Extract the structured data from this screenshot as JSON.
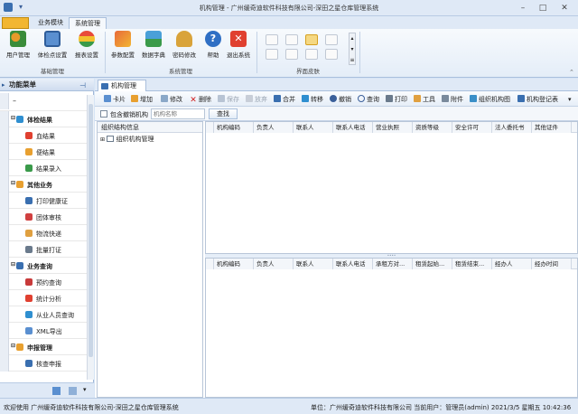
{
  "window": {
    "title": "机构管理 - 广州缓奇迪软件科技有限公司-深田之星仓库管理系统"
  },
  "ribbon_tabs": [
    "",
    "业务模块",
    "系统管理"
  ],
  "ribbon": {
    "buttons": [
      "用户管理",
      "体检点设置",
      "报表设置",
      "参数配置",
      "数据字典",
      "密码修改",
      "帮助",
      "退出系统"
    ],
    "groups": [
      "基础管理",
      "系统管理",
      "界面皮肤"
    ]
  },
  "sidebar": {
    "title": "功能菜单",
    "items": [
      {
        "label": "体检结果",
        "cat": true
      },
      {
        "label": "血结果",
        "cat": false
      },
      {
        "label": "便结果",
        "cat": false
      },
      {
        "label": "结果录入",
        "cat": false
      },
      {
        "label": "其他业务",
        "cat": true
      },
      {
        "label": "打印健康证",
        "cat": false
      },
      {
        "label": "团体审核",
        "cat": false
      },
      {
        "label": "物流快递",
        "cat": false
      },
      {
        "label": "批量打证",
        "cat": false
      },
      {
        "label": "业务查询",
        "cat": true
      },
      {
        "label": "预约查询",
        "cat": false
      },
      {
        "label": "统计分析",
        "cat": false
      },
      {
        "label": "从业人员查询",
        "cat": false
      },
      {
        "label": "XML导出",
        "cat": false
      },
      {
        "label": "申报管理",
        "cat": true
      },
      {
        "label": "核查申报",
        "cat": false
      }
    ]
  },
  "doc_tab": "机构管理",
  "toolbar": [
    "卡片",
    "增加",
    "修改",
    "删除",
    "保存",
    "放弃",
    "合并",
    "转移",
    "撤销",
    "查询",
    "打印",
    "工具",
    "附件",
    "组织机构图",
    "机构登记表"
  ],
  "filter": {
    "checkbox_label": "包含撤销机构",
    "placeholder": "机构名称",
    "search_label": "查找"
  },
  "tree": {
    "header": "组织结构信息",
    "root": "组织机构管理"
  },
  "grid_top": {
    "columns": [
      "机构编码",
      "负责人",
      "联系人",
      "联系人电话",
      "营业执照",
      "资质等级",
      "安全许可",
      "法人委托书",
      "其他证件"
    ]
  },
  "grid_bottom": {
    "columns": [
      "机构编码",
      "负责人",
      "联系人",
      "联系人电话",
      "承租方对...",
      "租赁起始...",
      "租赁结束...",
      "经办人",
      "经办时间"
    ]
  },
  "status": {
    "left": "欢迎使用 广州缓奇迪软件科技有限公司-深田之星仓库管理系统",
    "right": "单位：广州缓奇迪软件科技有限公司 当前用户：管理员(admin)  2021/3/5 星期五 10:42:36"
  }
}
